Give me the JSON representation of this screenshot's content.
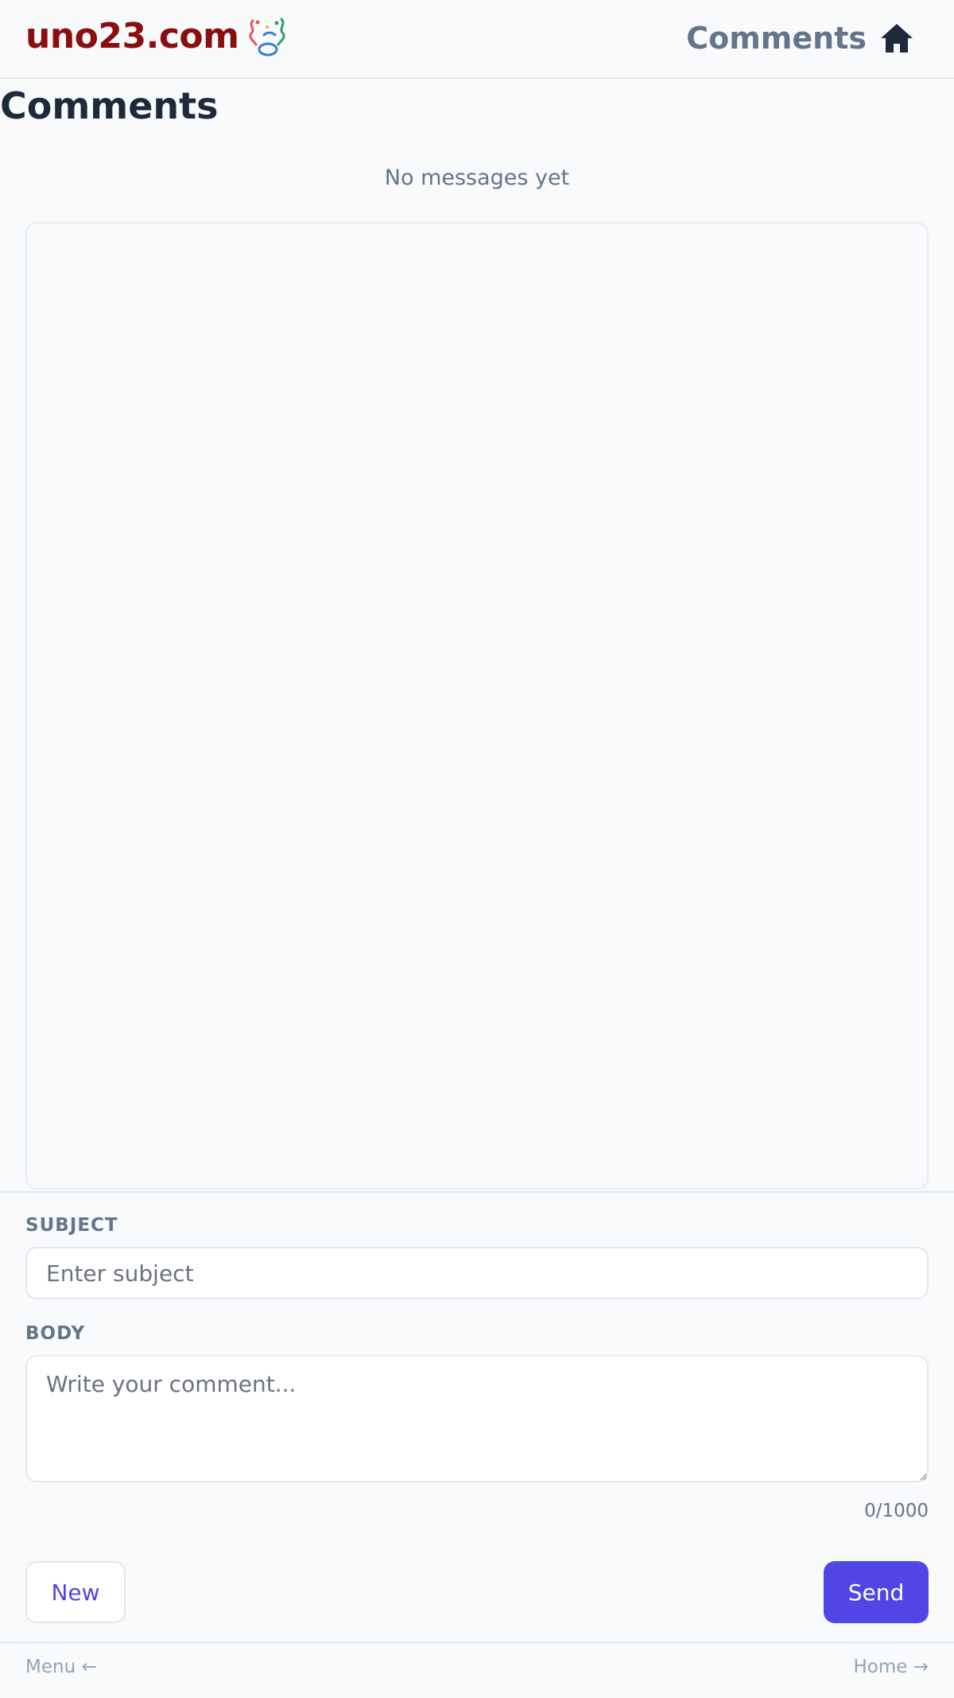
{
  "header": {
    "brand": "uno23.com",
    "title": "Comments",
    "home_icon": "home-icon",
    "logo_icon": "balloon-logo-icon"
  },
  "main": {
    "title": "Comments",
    "empty_message": "No messages yet"
  },
  "form": {
    "subject_label": "SUBJECT",
    "subject_placeholder": "Enter subject",
    "body_label": "BODY",
    "body_placeholder": "Write your comment...",
    "counter": "0/1000",
    "new_label": "New",
    "send_label": "Send"
  },
  "footer": {
    "menu_label": "Menu ←",
    "home_label": "Home →"
  },
  "colors": {
    "brand": "#8b0e0e",
    "accent": "#4f46e5",
    "background": "#f8fafc",
    "muted": "#64748b"
  }
}
